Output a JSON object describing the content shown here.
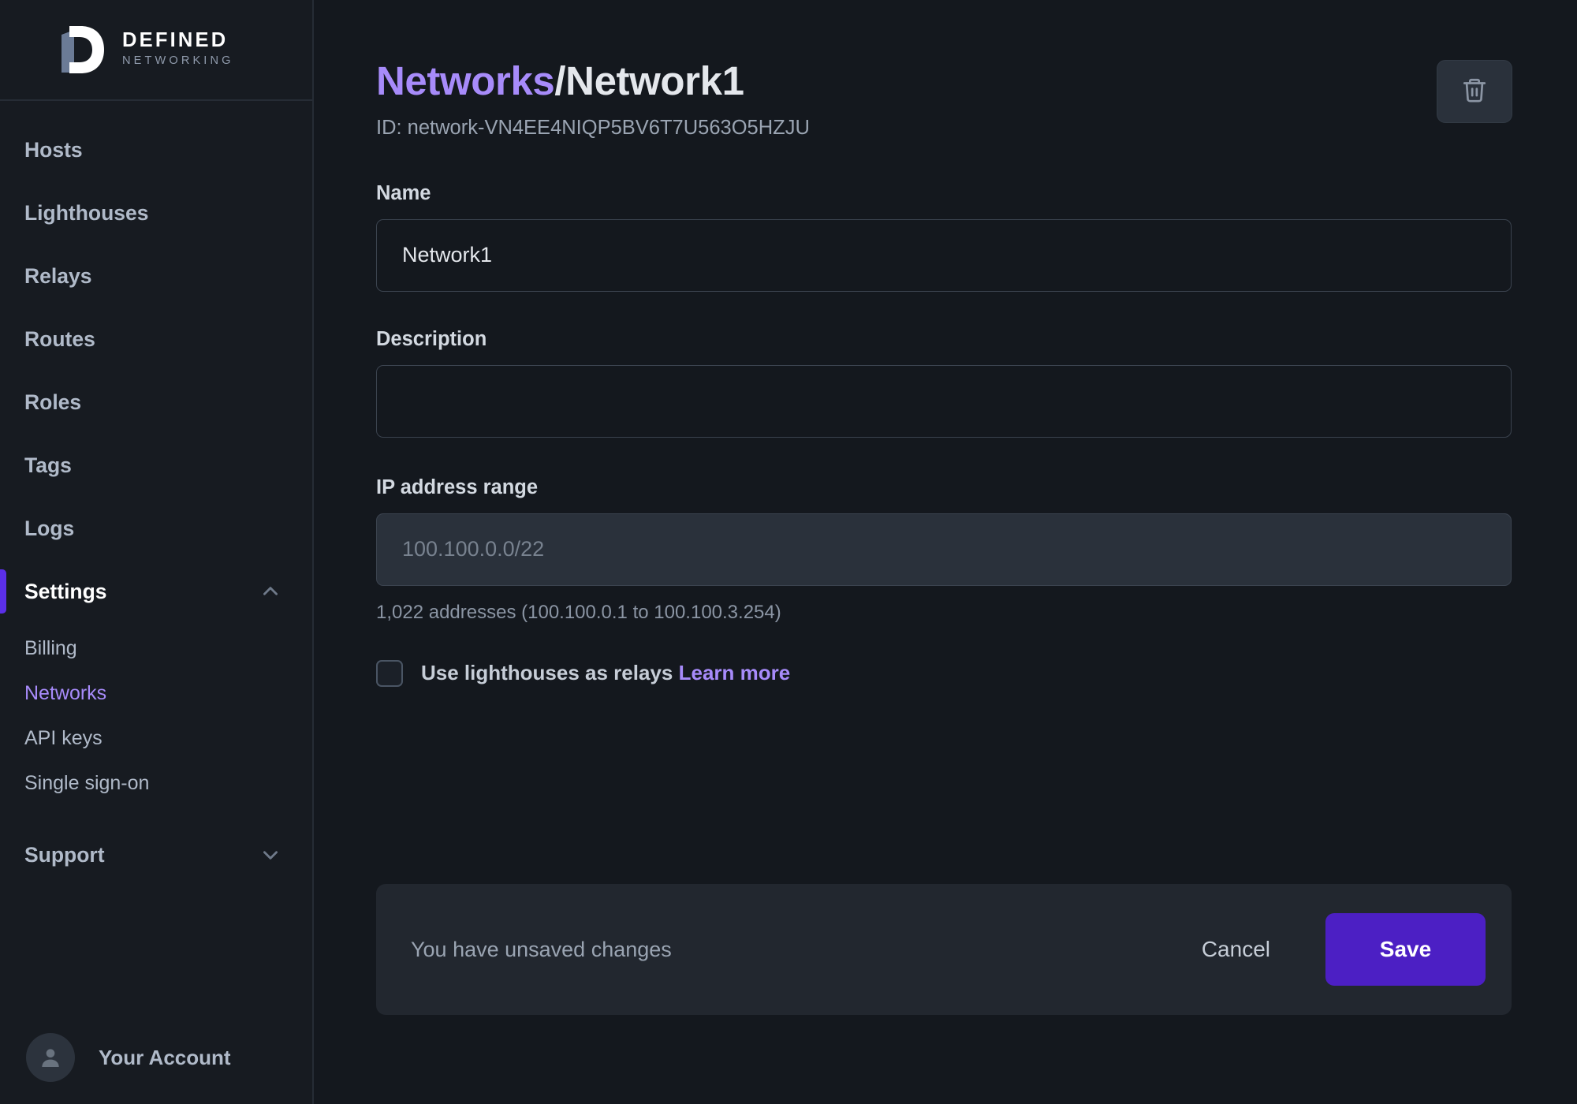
{
  "brand": {
    "line1": "DEFINED",
    "line2": "NETWORKING",
    "logo_icon": "defined-networking-d-logo"
  },
  "sidebar": {
    "nav": [
      {
        "label": "Hosts",
        "active": false
      },
      {
        "label": "Lighthouses",
        "active": false
      },
      {
        "label": "Relays",
        "active": false
      },
      {
        "label": "Routes",
        "active": false
      },
      {
        "label": "Roles",
        "active": false
      },
      {
        "label": "Tags",
        "active": false
      },
      {
        "label": "Logs",
        "active": false
      }
    ],
    "settings": {
      "label": "Settings",
      "active": true,
      "chevron_icon": "chevron-up-icon",
      "expanded": true,
      "items": [
        {
          "label": "Billing",
          "current": false
        },
        {
          "label": "Networks",
          "current": true
        },
        {
          "label": "API keys",
          "current": false
        },
        {
          "label": "Single sign-on",
          "current": false
        }
      ]
    },
    "support": {
      "label": "Support",
      "chevron_icon": "chevron-down-icon",
      "expanded": false
    },
    "account": {
      "label": "Your Account",
      "avatar_icon": "user-avatar-icon"
    }
  },
  "header": {
    "breadcrumb_parent": "Networks",
    "breadcrumb_separator": "/",
    "breadcrumb_current": "Network1",
    "id_text": "ID: network-VN4EE4NIQP5BV6T7U563O5HZJU",
    "delete_icon": "trash-icon"
  },
  "form": {
    "name": {
      "label": "Name",
      "value": "Network1",
      "placeholder": ""
    },
    "description": {
      "label": "Description",
      "value": "",
      "placeholder": ""
    },
    "ip_range": {
      "label": "IP address range",
      "value": "100.100.0.0/22",
      "placeholder": "100.100.0.0/22",
      "help": "1,022 addresses (100.100.0.1 to 100.100.3.254)",
      "disabled": true
    },
    "lighthouse_relays": {
      "label": "Use lighthouses as relays",
      "link_label": "Learn more",
      "checked": false
    }
  },
  "savebar": {
    "message": "You have unsaved changes",
    "cancel_label": "Cancel",
    "save_label": "Save"
  },
  "colors": {
    "accent_purple": "#A78BFA",
    "save_button": "#4C1FC4",
    "active_indicator": "#5B2FE8",
    "sidebar_bg": "#171B21",
    "main_bg": "#14181E",
    "savebar_bg": "#22272F"
  }
}
